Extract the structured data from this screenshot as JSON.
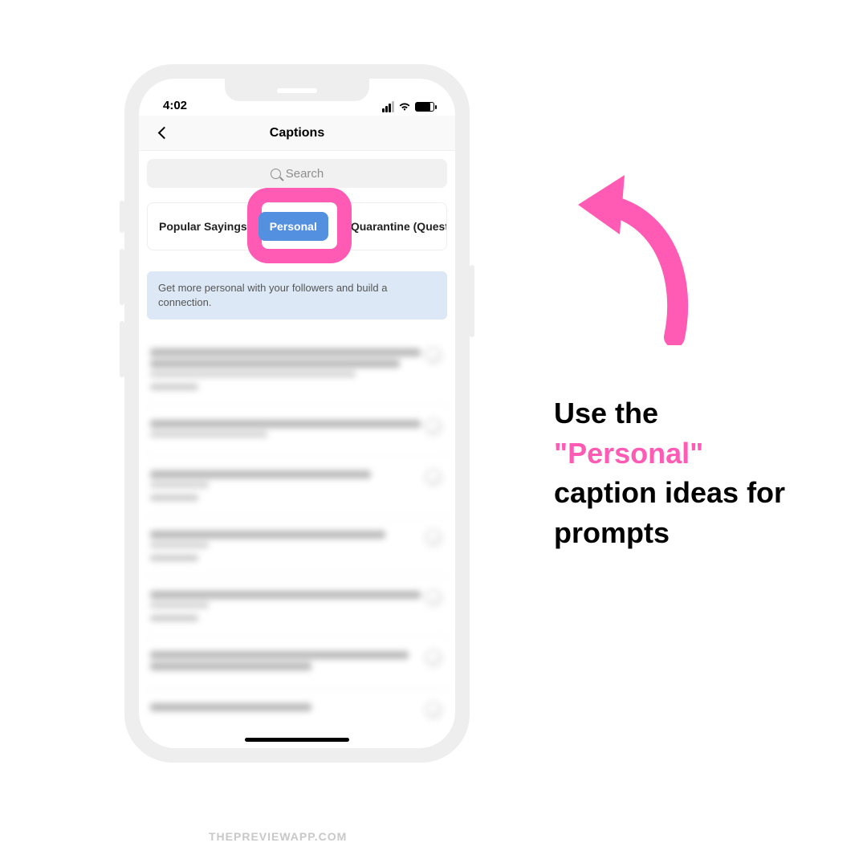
{
  "status": {
    "time": "4:02"
  },
  "nav": {
    "title": "Captions"
  },
  "search": {
    "placeholder": "Search"
  },
  "tabs": {
    "left": "Popular Sayings",
    "center": "Personal",
    "right": "Quarantine (Questions)"
  },
  "info": {
    "text": "Get more personal with your followers and build a connection."
  },
  "callout": {
    "line1": "Use the",
    "accent": "\"Personal\"",
    "line3": "caption ideas for prompts"
  },
  "watermark": "THEPREVIEWAPP.COM",
  "colors": {
    "pink": "#ff5ab4",
    "blue": "#5391e0"
  }
}
